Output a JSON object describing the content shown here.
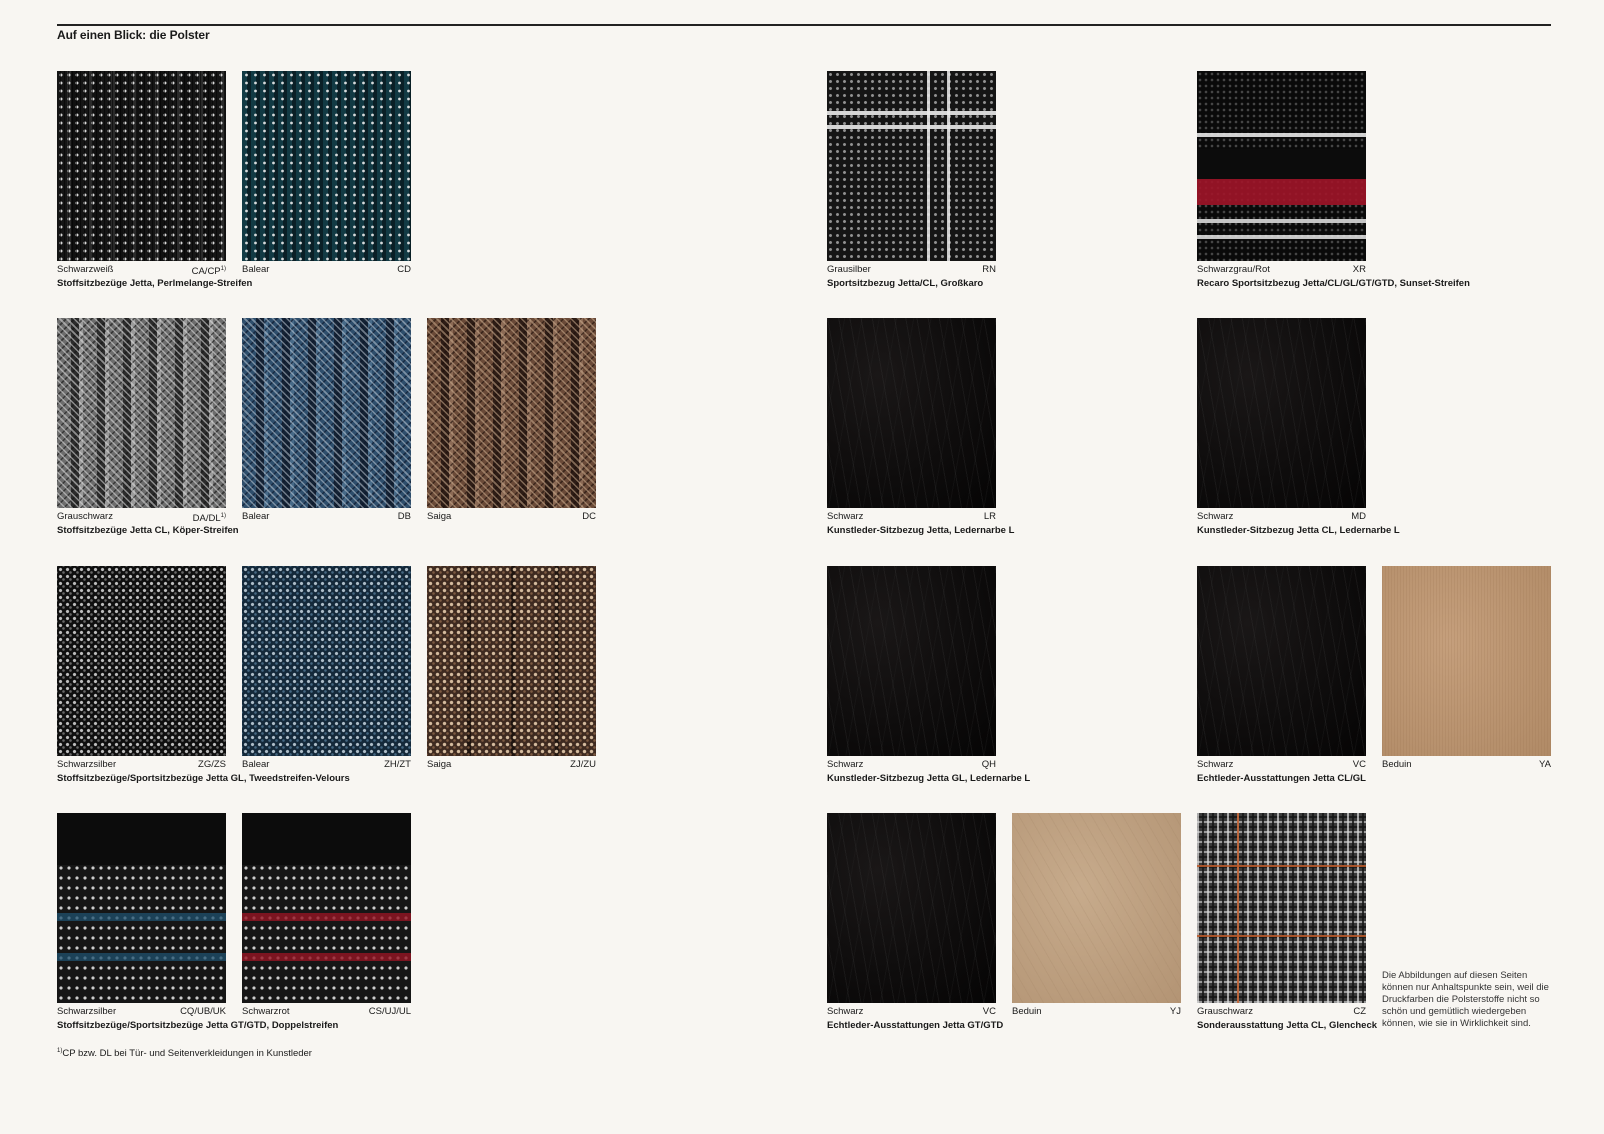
{
  "title": "Auf einen Blick: die Polster",
  "groups": [
    {
      "caption": "Stoffsitzbezüge Jetta, Perlmelange-Streifen",
      "swatches": [
        {
          "name": "Schwarzweiß",
          "code": "CA/CP",
          "fn": "1)"
        },
        {
          "name": "Balear",
          "code": "CD"
        }
      ]
    },
    {
      "caption": "Stoffsitzbezüge Jetta CL, Köper-Streifen",
      "swatches": [
        {
          "name": "Grauschwarz",
          "code": "DA/DL",
          "fn": "1)"
        },
        {
          "name": "Balear",
          "code": "DB"
        },
        {
          "name": "Saiga",
          "code": "DC"
        }
      ]
    },
    {
      "caption": "Stoffsitzbezüge/Sportsitzbezüge Jetta GL, Tweedstreifen-Velours",
      "swatches": [
        {
          "name": "Schwarzsilber",
          "code": "ZG/ZS"
        },
        {
          "name": "Balear",
          "code": "ZH/ZT"
        },
        {
          "name": "Saiga",
          "code": "ZJ/ZU"
        }
      ]
    },
    {
      "caption": "Stoffsitzbezüge/Sportsitzbezüge Jetta GT/GTD, Doppelstreifen",
      "swatches": [
        {
          "name": "Schwarzsilber",
          "code": "CQ/UB/UK"
        },
        {
          "name": "Schwarzrot",
          "code": "CS/UJ/UL"
        }
      ]
    },
    {
      "caption": "Sportsitzbezug Jetta/CL, Großkaro",
      "swatches": [
        {
          "name": "Grausilber",
          "code": "RN"
        }
      ]
    },
    {
      "caption": "Recaro Sportsitzbezug Jetta/CL/GL/GT/GTD, Sunset-Streifen",
      "swatches": [
        {
          "name": "Schwarzgrau/Rot",
          "code": "XR"
        }
      ]
    },
    {
      "caption": "Kunstleder-Sitzbezug Jetta, Ledernarbe L",
      "swatches": [
        {
          "name": "Schwarz",
          "code": "LR"
        }
      ]
    },
    {
      "caption": "Kunstleder-Sitzbezug Jetta CL, Ledernarbe L",
      "swatches": [
        {
          "name": "Schwarz",
          "code": "MD"
        }
      ]
    },
    {
      "caption": "Kunstleder-Sitzbezug Jetta GL, Ledernarbe L",
      "swatches": [
        {
          "name": "Schwarz",
          "code": "QH"
        }
      ]
    },
    {
      "caption": "Echtleder-Ausstattungen Jetta CL/GL",
      "swatches": [
        {
          "name": "Schwarz",
          "code": "VC"
        },
        {
          "name": "Beduin",
          "code": "YA"
        }
      ]
    },
    {
      "caption": "Echtleder-Ausstattungen Jetta GT/GTD",
      "swatches": [
        {
          "name": "Schwarz",
          "code": "VC"
        },
        {
          "name": "Beduin",
          "code": "YJ"
        }
      ]
    },
    {
      "caption": "Sonderausstattung Jetta CL, Glencheck",
      "swatches": [
        {
          "name": "Grauschwarz",
          "code": "CZ"
        }
      ]
    }
  ],
  "footnote": {
    "mark": "1)",
    "text": "CP bzw. DL bei Tür- und Seitenverkleidungen in Kunstleder"
  },
  "note": "Die Abbildungen auf diesen Seiten können nur Anhaltspunkte sein, weil die Druckfarben die Polsterstoffe nicht so schön und gemütlich wiedergeben können, wie sie in Wirklichkeit sind."
}
